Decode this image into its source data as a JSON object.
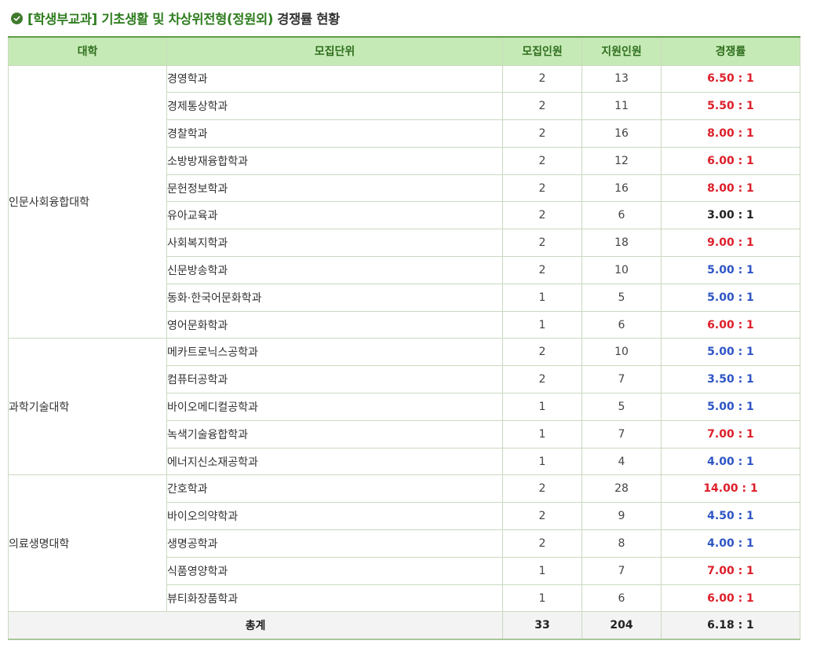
{
  "title": {
    "accent": "[학생부교과] 기초생활 및 차상위전형(정원외)",
    "rest": "경쟁률 현황"
  },
  "headers": [
    "대학",
    "모집단위",
    "모집인원",
    "지원인원",
    "경쟁률"
  ],
  "groups": [
    {
      "college": "인문사회융합대학",
      "rows": [
        {
          "unit": "경영학과",
          "quota": "2",
          "applicants": "13",
          "rate": "6.50 : 1",
          "color": "red"
        },
        {
          "unit": "경제통상학과",
          "quota": "2",
          "applicants": "11",
          "rate": "5.50 : 1",
          "color": "red"
        },
        {
          "unit": "경찰학과",
          "quota": "2",
          "applicants": "16",
          "rate": "8.00 : 1",
          "color": "red"
        },
        {
          "unit": "소방방재융합학과",
          "quota": "2",
          "applicants": "12",
          "rate": "6.00 : 1",
          "color": "red"
        },
        {
          "unit": "문헌정보학과",
          "quota": "2",
          "applicants": "16",
          "rate": "8.00 : 1",
          "color": "red"
        },
        {
          "unit": "유아교육과",
          "quota": "2",
          "applicants": "6",
          "rate": "3.00 : 1",
          "color": "black"
        },
        {
          "unit": "사회복지학과",
          "quota": "2",
          "applicants": "18",
          "rate": "9.00 : 1",
          "color": "red"
        },
        {
          "unit": "신문방송학과",
          "quota": "2",
          "applicants": "10",
          "rate": "5.00 : 1",
          "color": "blue"
        },
        {
          "unit": "동화·한국어문화학과",
          "quota": "1",
          "applicants": "5",
          "rate": "5.00 : 1",
          "color": "blue"
        },
        {
          "unit": "영어문화학과",
          "quota": "1",
          "applicants": "6",
          "rate": "6.00 : 1",
          "color": "red"
        }
      ]
    },
    {
      "college": "과학기술대학",
      "rows": [
        {
          "unit": "메카트로닉스공학과",
          "quota": "2",
          "applicants": "10",
          "rate": "5.00 : 1",
          "color": "blue"
        },
        {
          "unit": "컴퓨터공학과",
          "quota": "2",
          "applicants": "7",
          "rate": "3.50 : 1",
          "color": "blue"
        },
        {
          "unit": "바이오메디컬공학과",
          "quota": "1",
          "applicants": "5",
          "rate": "5.00 : 1",
          "color": "blue"
        },
        {
          "unit": "녹색기술융합학과",
          "quota": "1",
          "applicants": "7",
          "rate": "7.00 : 1",
          "color": "red"
        },
        {
          "unit": "에너지신소재공학과",
          "quota": "1",
          "applicants": "4",
          "rate": "4.00 : 1",
          "color": "blue"
        }
      ]
    },
    {
      "college": "의료생명대학",
      "rows": [
        {
          "unit": "간호학과",
          "quota": "2",
          "applicants": "28",
          "rate": "14.00 : 1",
          "color": "red"
        },
        {
          "unit": "바이오의약학과",
          "quota": "2",
          "applicants": "9",
          "rate": "4.50 : 1",
          "color": "blue"
        },
        {
          "unit": "생명공학과",
          "quota": "2",
          "applicants": "8",
          "rate": "4.00 : 1",
          "color": "blue"
        },
        {
          "unit": "식품영양학과",
          "quota": "1",
          "applicants": "7",
          "rate": "7.00 : 1",
          "color": "red"
        },
        {
          "unit": "뷰티화장품학과",
          "quota": "1",
          "applicants": "6",
          "rate": "6.00 : 1",
          "color": "red"
        }
      ]
    }
  ],
  "total": {
    "label": "총계",
    "quota": "33",
    "applicants": "204",
    "rate": "6.18 : 1"
  },
  "colors": {
    "accent_green": "#2f7d1f",
    "header_bg": "#c6eab6",
    "rate_red": "#dd1f2a",
    "rate_blue": "#2f55c5"
  },
  "icons": {
    "title": "check-circle-icon"
  }
}
